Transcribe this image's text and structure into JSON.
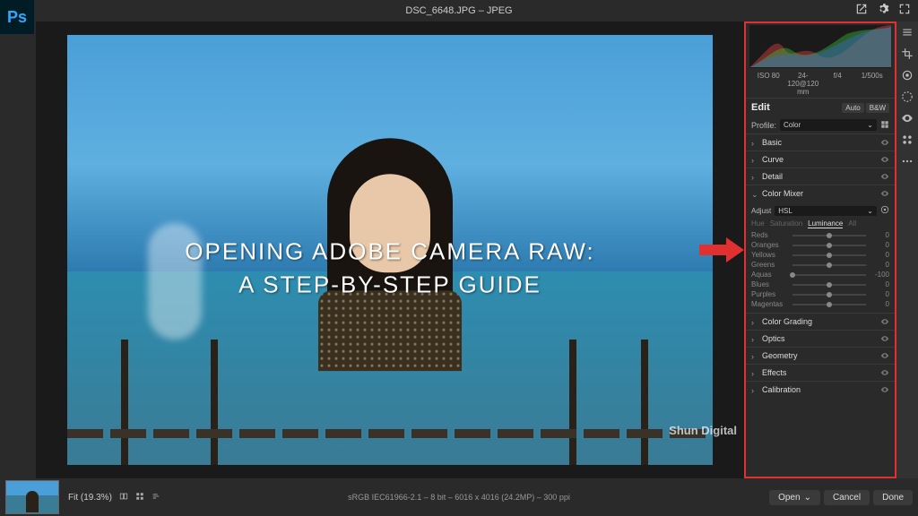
{
  "topbar": {
    "logo_text": "Ps",
    "filename": "DSC_6648.JPG – JPEG"
  },
  "overlay": {
    "line1": "OPENING ADOBE CAMERA RAW:",
    "line2": "A STEP-BY-STEP GUIDE"
  },
  "exif": {
    "iso": "ISO 80",
    "lens": "24-120@120 mm",
    "aperture": "f/4",
    "shutter": "1/500s"
  },
  "edit": {
    "label": "Edit",
    "auto": "Auto",
    "bw": "B&W",
    "profile_label": "Profile:",
    "profile_value": "Color"
  },
  "sections": {
    "basic": "Basic",
    "curve": "Curve",
    "detail": "Detail",
    "color_mixer": "Color Mixer",
    "color_grading": "Color Grading",
    "optics": "Optics",
    "geometry": "Geometry",
    "effects": "Effects",
    "calibration": "Calibration"
  },
  "color_mixer": {
    "adjust_label": "Adjust",
    "adjust_value": "HSL",
    "tabs": {
      "hue": "Hue",
      "saturation": "Saturation",
      "luminance": "Luminance",
      "all": "All"
    },
    "sliders": [
      {
        "name": "Reds",
        "value": "0",
        "pos": 50
      },
      {
        "name": "Oranges",
        "value": "0",
        "pos": 50
      },
      {
        "name": "Yellows",
        "value": "0",
        "pos": 50
      },
      {
        "name": "Greens",
        "value": "0",
        "pos": 50
      },
      {
        "name": "Aquas",
        "value": "-100",
        "pos": 0
      },
      {
        "name": "Blues",
        "value": "0",
        "pos": 50
      },
      {
        "name": "Purples",
        "value": "0",
        "pos": 50
      },
      {
        "name": "Magentas",
        "value": "0",
        "pos": 50
      }
    ]
  },
  "footer": {
    "fit": "Fit (19.3%)",
    "center": "sRGB IEC61966-2.1 – 8 bit – 6016 x 4016 (24.2MP) – 300 ppi",
    "open": "Open",
    "cancel": "Cancel",
    "done": "Done"
  },
  "watermark": "Shun Digital"
}
